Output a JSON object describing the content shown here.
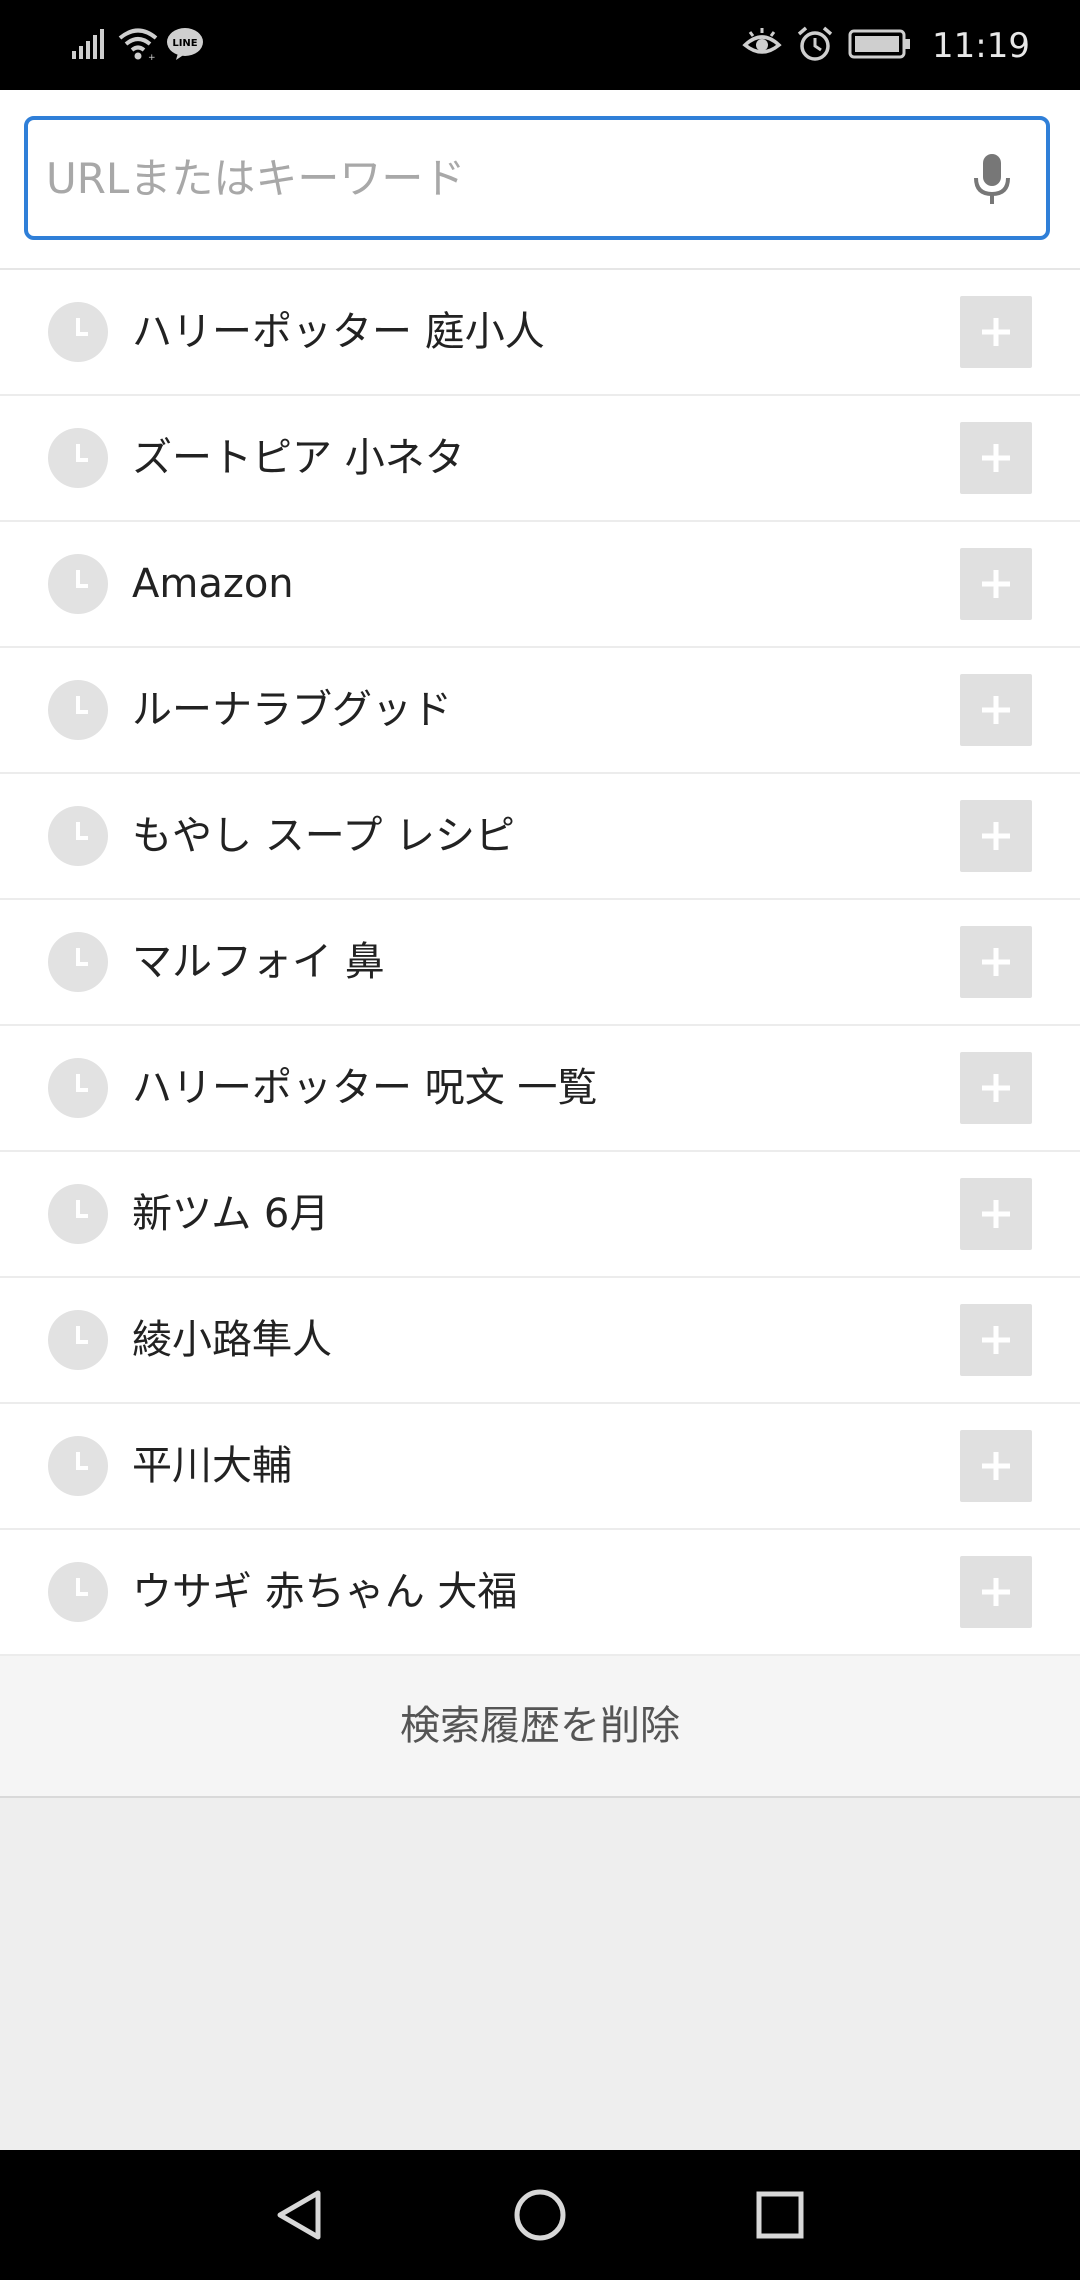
{
  "status_bar": {
    "time": "11:19",
    "line_badge": "LINE",
    "icons": [
      "signal-icon",
      "wifi-icon",
      "line-icon",
      "eye-comfort-icon",
      "alarm-icon",
      "battery-icon"
    ]
  },
  "search": {
    "placeholder": "URLまたはキーワード",
    "value": "",
    "accent_color": "#2f7fd8"
  },
  "history": {
    "items": [
      {
        "label": "ハリーポッター 庭小人"
      },
      {
        "label": "ズートピア 小ネタ"
      },
      {
        "label": "Amazon"
      },
      {
        "label": "ルーナラブグッド"
      },
      {
        "label": "もやし スープ レシピ"
      },
      {
        "label": "マルフォイ 鼻"
      },
      {
        "label": "ハリーポッター 呪文 一覧"
      },
      {
        "label": "新ツム 6月"
      },
      {
        "label": "綾小路隼人"
      },
      {
        "label": "平川大輔"
      },
      {
        "label": "ウサギ 赤ちゃん 大福"
      }
    ],
    "clear_label": "検索履歴を削除"
  },
  "nav_bar": {
    "buttons": [
      "back-icon",
      "home-icon",
      "recents-icon"
    ]
  }
}
